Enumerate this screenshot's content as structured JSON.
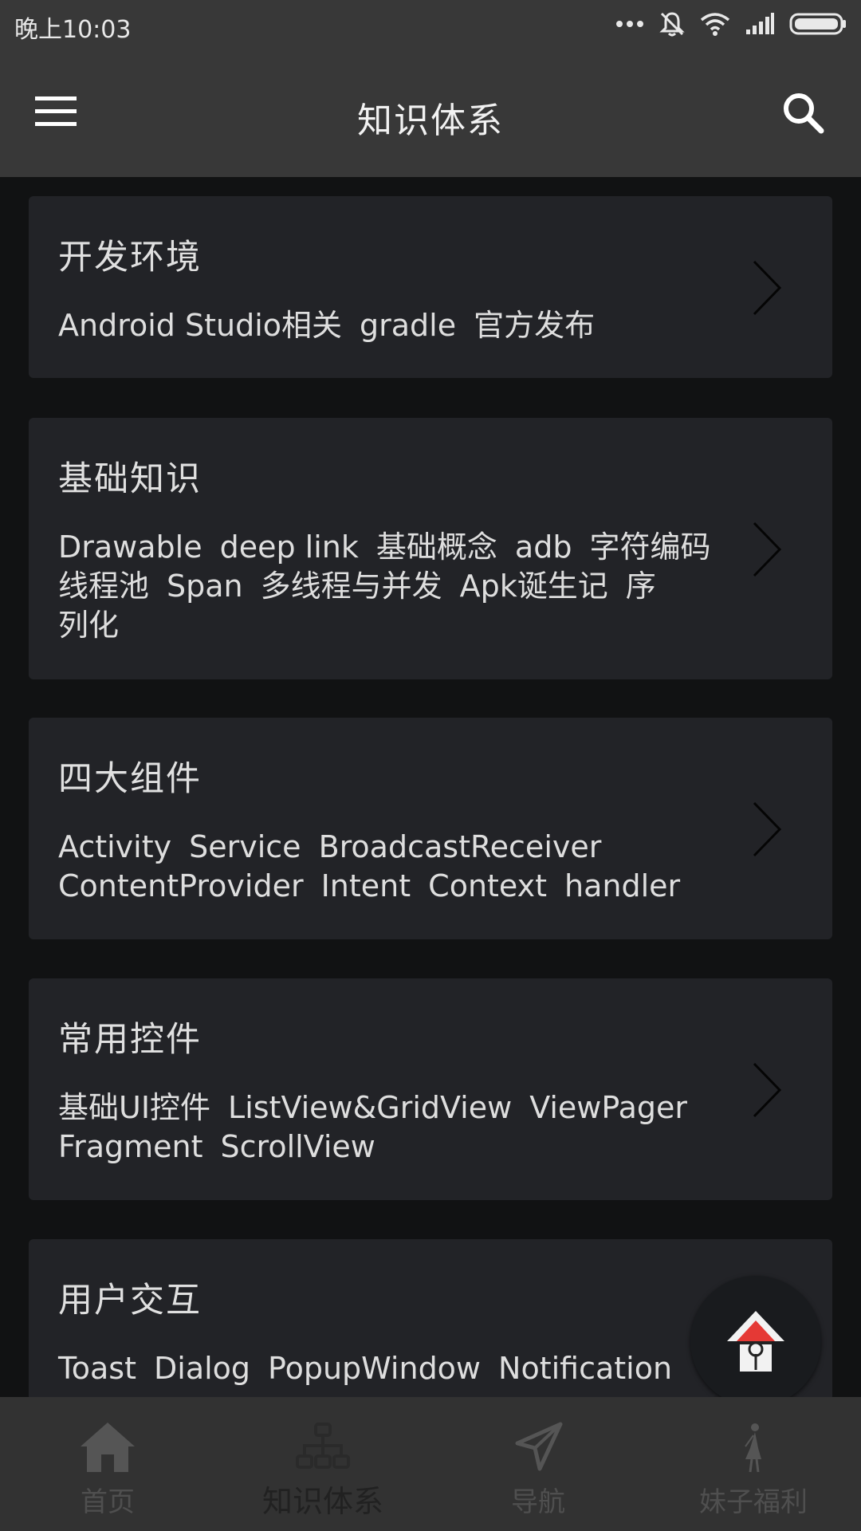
{
  "status_bar": {
    "time": "晚上10:03"
  },
  "app_bar": {
    "title": "知识体系"
  },
  "cards": [
    {
      "title": "开发环境",
      "tags": [
        "Android Studio相关",
        "gradle",
        "官方发布"
      ]
    },
    {
      "title": "基础知识",
      "tags": [
        "Drawable",
        "deep link",
        "基础概念",
        "adb",
        "字符编码",
        "线程池",
        "Span",
        "多线程与并发",
        "Apk诞生记",
        "序",
        "列化"
      ]
    },
    {
      "title": "四大组件",
      "tags": [
        "Activity",
        "Service",
        "BroadcastReceiver",
        "ContentProvider",
        "Intent",
        "Context",
        "handler"
      ]
    },
    {
      "title": "常用控件",
      "tags": [
        "基础UI控件",
        "ListView&GridView",
        "ViewPager",
        "Fragment",
        "ScrollView"
      ]
    },
    {
      "title": "用户交互",
      "tags": [
        "Toast",
        "Dialog",
        "PopupWindow",
        "Notification"
      ]
    }
  ],
  "bottom_nav": [
    {
      "label": "首页",
      "icon": "home-icon"
    },
    {
      "label": "知识体系",
      "icon": "hierarchy-icon",
      "active": true
    },
    {
      "label": "导航",
      "icon": "navigation-arrow-icon"
    },
    {
      "label": "妹子福利",
      "icon": "girl-icon"
    }
  ],
  "colors": {
    "background": "#111213",
    "card": "#222327",
    "app_bar": "#383838",
    "nav_bar": "#323232"
  }
}
